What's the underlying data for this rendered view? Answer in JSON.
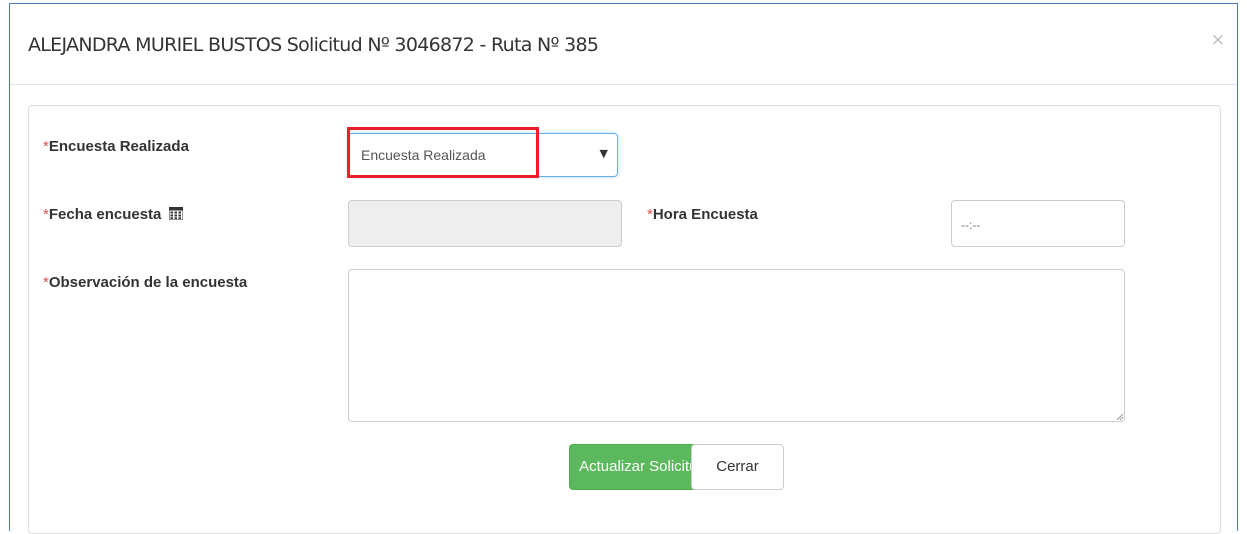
{
  "modal": {
    "title": "ALEJANDRA MURIEL BUSTOS Solicitud Nº 3046872 - Ruta Nº 385",
    "close_glyph": "×"
  },
  "form": {
    "required_mark": "*",
    "encuesta_realizada": {
      "label": "Encuesta Realizada",
      "selected_value": "Encuesta Realizada",
      "caret": "▼"
    },
    "fecha_encuesta": {
      "label": "Fecha encuesta",
      "icon": "calendar-icon",
      "value": ""
    },
    "hora_encuesta": {
      "label": "Hora Encuesta",
      "value": "--:--"
    },
    "observacion": {
      "label": "Observación de la encuesta",
      "value": ""
    }
  },
  "actions": {
    "submit_label": "Actualizar Solicitud",
    "close_label": "Cerrar"
  },
  "colors": {
    "modal_border": "#4b79b6",
    "primary_button": "#5cb85c",
    "required_asterisk": "#d9534f",
    "annotation_highlight": "#e8202a",
    "focus_border": "#66afe9"
  }
}
